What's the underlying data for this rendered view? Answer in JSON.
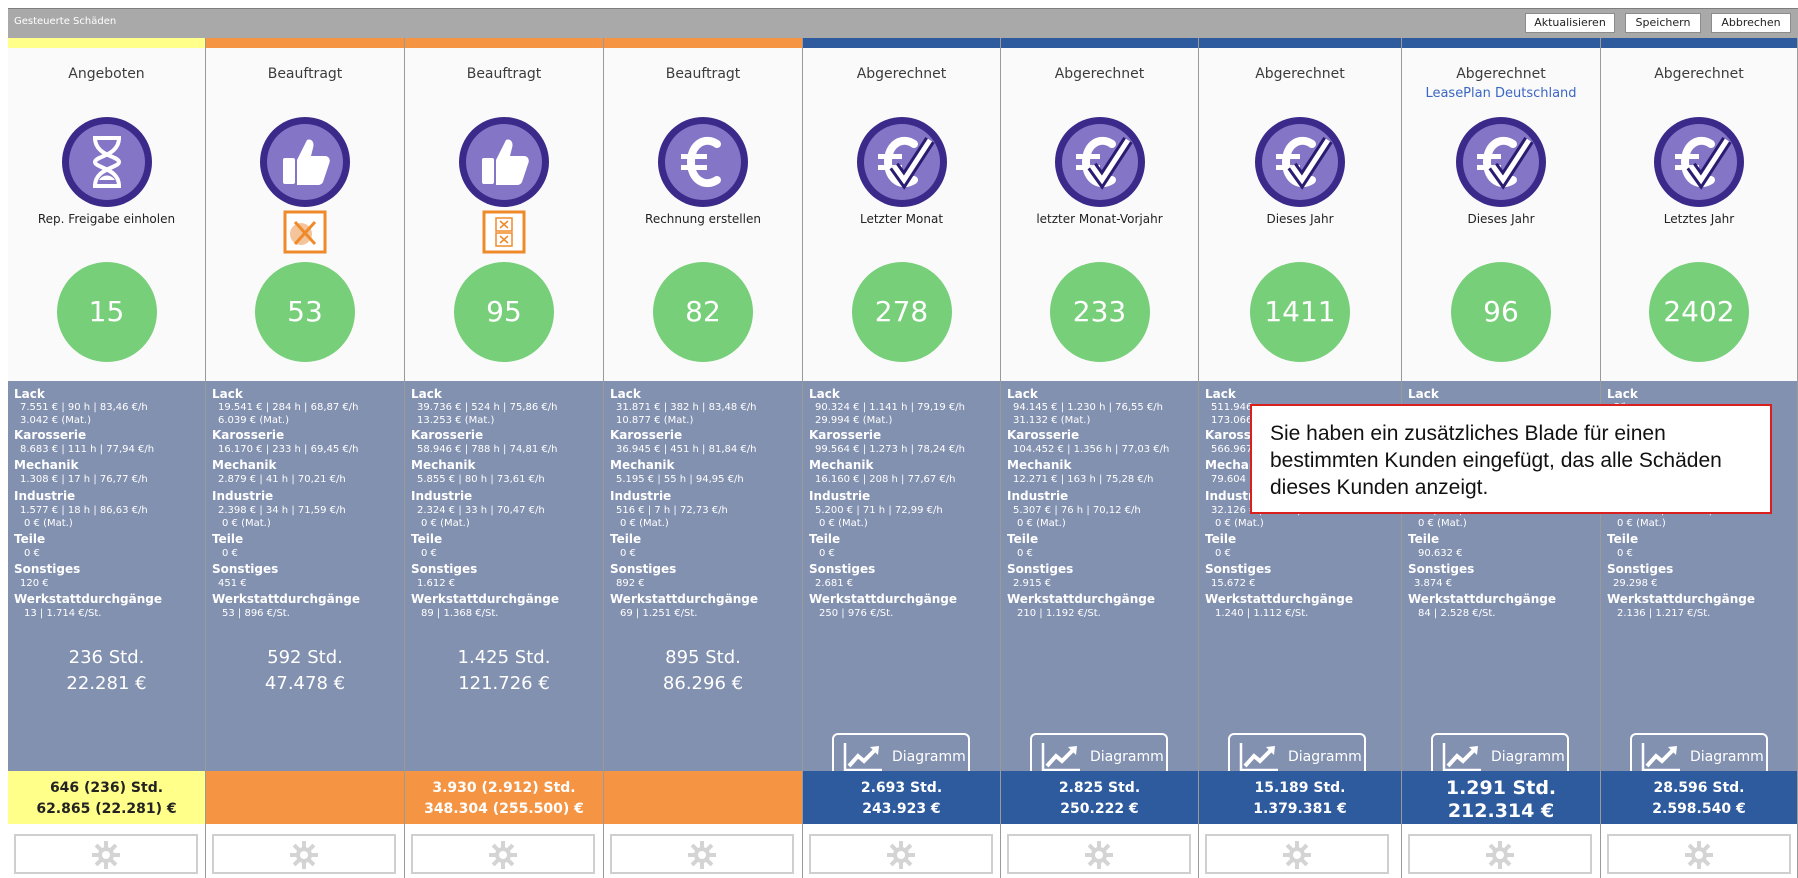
{
  "window": {
    "title": "Gesteuerte Schäden"
  },
  "toolbar": {
    "refresh": "Aktualisieren",
    "save": "Speichern",
    "cancel": "Abbrechen"
  },
  "callout": "Sie haben ein zusätzliches Blade für einen bestimmten Kunden eingefügt, das alle Schäden dieses Kunden anzeigt.",
  "labels": {
    "lack": "Lack",
    "karosserie": "Karosserie",
    "mechanik": "Mechanik",
    "industrie": "Industrie",
    "teile": "Teile",
    "sonstiges": "Sonstiges",
    "werkstatt": "Werkstattdurchgänge",
    "diagramm": "Diagramm"
  },
  "colors": {
    "yellow": "#ffff8a",
    "orange": "#f59443",
    "blue": "#2e5a9e",
    "panel": "#8391b0",
    "circle": "#77cf79",
    "icon": "#6a5aa8"
  },
  "columns": [
    {
      "status": "Angeboten",
      "subtitle": "",
      "icon": "hourglass-icon",
      "label": "Rep. Freigabe einholen",
      "warn": "",
      "count": "15",
      "accent": "yellow",
      "lack1": "7.551 € | 90 h | 83,46 €/h",
      "lack2": "3.042 € (Mat.)",
      "karosserie": "8.683 € | 111 h | 77,94 €/h",
      "mechanik": "1.308 € | 17 h | 76,77 €/h",
      "industrie1": "1.577 € | 18 h | 86,63 €/h",
      "industrie2": "0 € (Mat.)",
      "teile": "0 €",
      "sonstiges": "120 €",
      "werkstatt": "13 | 1.714 €/St.",
      "hours": "236 Std.",
      "amount": "22.281 €",
      "footer1": "646 (236) Std.",
      "footer2": "62.865 (22.281) €"
    },
    {
      "status": "Beauftragt",
      "subtitle": "",
      "icon": "thumbs-up-icon",
      "label": "",
      "warn": "warning-tool-icon",
      "count": "53",
      "accent": "orange",
      "lack1": "19.541 € | 284 h | 68,87 €/h",
      "lack2": "6.039 € (Mat.)",
      "karosserie": "16.170 € | 233 h | 69,45 €/h",
      "mechanik": "2.879 € | 41 h | 70,21 €/h",
      "industrie1": "2.398 € | 34 h | 71,59 €/h",
      "industrie2": "0 € (Mat.)",
      "teile": "0 €",
      "sonstiges": "451 €",
      "werkstatt": "53 | 896 €/St.",
      "hours": "592 Std.",
      "amount": "47.478 €",
      "footer1": "",
      "footer2": ""
    },
    {
      "status": "Beauftragt",
      "subtitle": "",
      "icon": "thumbs-up-icon",
      "label": "",
      "warn": "warning-box-icon",
      "count": "95",
      "accent": "orange",
      "lack1": "39.736 € | 524 h | 75,86 €/h",
      "lack2": "13.253 € (Mat.)",
      "karosserie": "58.946 € | 788 h | 74,81 €/h",
      "mechanik": "5.855 € | 80 h | 73,61 €/h",
      "industrie1": "2.324 € | 33 h | 70,47 €/h",
      "industrie2": "0 € (Mat.)",
      "teile": "0 €",
      "sonstiges": "1.612 €",
      "werkstatt": "89 | 1.368 €/St.",
      "hours": "1.425 Std.",
      "amount": "121.726 €",
      "footer1": "3.930 (2.912) Std.",
      "footer2": "348.304 (255.500) €"
    },
    {
      "status": "Beauftragt",
      "subtitle": "",
      "icon": "euro-icon",
      "label": "Rechnung erstellen",
      "warn": "",
      "count": "82",
      "accent": "orange",
      "lack1": "31.871 € | 382 h | 83,48 €/h",
      "lack2": "10.877 € (Mat.)",
      "karosserie": "36.945 € | 451 h | 81,84 €/h",
      "mechanik": "5.195 € | 55 h | 94,95 €/h",
      "industrie1": "516 € | 7 h | 72,73 €/h",
      "industrie2": "0 € (Mat.)",
      "teile": "0 €",
      "sonstiges": "892 €",
      "werkstatt": "69 | 1.251 €/St.",
      "hours": "895 Std.",
      "amount": "86.296 €",
      "footer1": "",
      "footer2": ""
    },
    {
      "status": "Abgerechnet",
      "subtitle": "",
      "icon": "euro-check-icon",
      "label": "Letzter Monat",
      "warn": "",
      "count": "278",
      "accent": "blue",
      "lack1": "90.324 € | 1.141 h | 79,19 €/h",
      "lack2": "29.994 € (Mat.)",
      "karosserie": "99.564 € | 1.273 h | 78,24 €/h",
      "mechanik": "16.160 € | 208 h | 77,67 €/h",
      "industrie1": "5.200 € | 71 h | 72,99 €/h",
      "industrie2": "0 € (Mat.)",
      "teile": "0 €",
      "sonstiges": "2.681 €",
      "werkstatt": "250 | 976 €/St.",
      "hours": "",
      "amount": "",
      "footer1": "2.693 Std.",
      "footer2": "243.923 €"
    },
    {
      "status": "Abgerechnet",
      "subtitle": "",
      "icon": "euro-check-icon",
      "label": "letzter Monat-Vorjahr",
      "warn": "",
      "count": "233",
      "accent": "blue",
      "lack1": "94.145 € | 1.230 h | 76,55 €/h",
      "lack2": "31.132 € (Mat.)",
      "karosserie": "104.452 € | 1.356 h | 77,03 €/h",
      "mechanik": "12.271 € | 163 h | 75,28 €/h",
      "industrie1": "5.307 € | 76 h | 70,12 €/h",
      "industrie2": "0 € (Mat.)",
      "teile": "0 €",
      "sonstiges": "2.915 €",
      "werkstatt": "210 | 1.192 €/St.",
      "hours": "",
      "amount": "",
      "footer1": "2.825 Std.",
      "footer2": "250.222 €"
    },
    {
      "status": "Abgerechnet",
      "subtitle": "",
      "icon": "euro-check-icon",
      "label": "Dieses Jahr",
      "warn": "",
      "count": "1411",
      "accent": "blue",
      "lack1": "511.946",
      "lack2": "173.066",
      "karosserie": "566.967",
      "mechanik": "79.604",
      "industrie1": "32.126 € | 436 h | 73,67 €/h",
      "industrie2": "0 € (Mat.)",
      "teile": "0 €",
      "sonstiges": "15.672 €",
      "werkstatt": "1.240 | 1.112 €/St.",
      "hours": "",
      "amount": "",
      "footer1": "15.189 Std.",
      "footer2": "1.379.381 €"
    },
    {
      "status": "Abgerechnet",
      "subtitle": "LeasePlan Deutschland",
      "icon": "euro-check-icon",
      "label": "Dieses Jahr",
      "warn": "",
      "count": "96",
      "accent": "blue",
      "lack1": "",
      "lack2": "",
      "karosserie": "",
      "mechanik": "",
      "industrie1": "0 € | 0 h | 0,00 €/h",
      "industrie2": "0 € (Mat.)",
      "teile": "90.632 €",
      "sonstiges": "3.874 €",
      "werkstatt": "84 | 2.528 €/St.",
      "hours": "",
      "amount": "",
      "footer1": "1.291 Std.",
      "footer2": "212.314 €"
    },
    {
      "status": "Abgerechnet",
      "subtitle": "",
      "icon": "euro-check-icon",
      "label": "Letztes Jahr",
      "warn": "",
      "count": "2402",
      "accent": "blue",
      "lack1": "€/h",
      "lack2": "",
      "karosserie": "€/h",
      "mechanik": "/h",
      "industrie1": "79.799 € | 1.066 h | 74,86 €/h",
      "industrie2": "0 € (Mat.)",
      "teile": "0 €",
      "sonstiges": "29.298 €",
      "werkstatt": "2.136 | 1.217 €/St.",
      "hours": "",
      "amount": "",
      "footer1": "28.596 Std.",
      "footer2": "2.598.540 €"
    }
  ]
}
